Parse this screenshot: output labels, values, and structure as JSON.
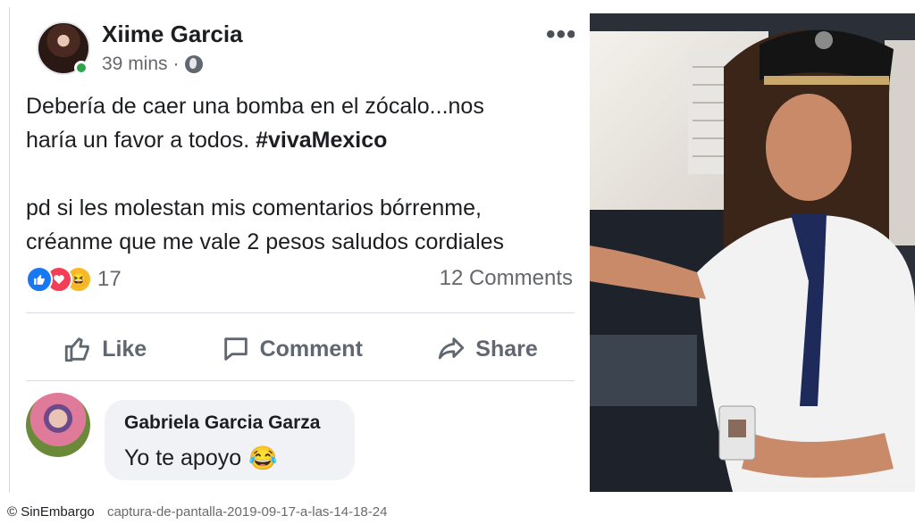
{
  "post": {
    "author": "Xiime Garcia",
    "time": "39 mins",
    "separator": "·",
    "menu": "•••",
    "text_line1": "Debería de caer una bomba en el zócalo...nos",
    "text_line2_pre": "haría un favor a todos. ",
    "hashtag": "#vivaMexico",
    "text_line3": "pd si les molestan mis comentarios bórrenme,",
    "text_line4": "créanme que me vale 2 pesos  saludos cordiales",
    "reaction_icons": [
      "like-icon",
      "love-icon",
      "haha-icon"
    ],
    "reaction_count": "17",
    "comments_count": "12 Comments",
    "actions": {
      "like": "Like",
      "comment": "Comment",
      "share": "Share"
    }
  },
  "comment": {
    "author": "Gabriela Garcia Garza",
    "text": "Yo te apoyo",
    "emoji": "😂"
  },
  "caption": {
    "source": "© SinEmbargo",
    "filename": "captura-de-pantalla-2019-09-17-a-las-14-18-24"
  },
  "colors": {
    "like_blue": "#1877f2",
    "love_red": "#f33e58",
    "haha_yellow": "#f7b928",
    "online_green": "#31a24c",
    "muted_text": "#65676b"
  }
}
